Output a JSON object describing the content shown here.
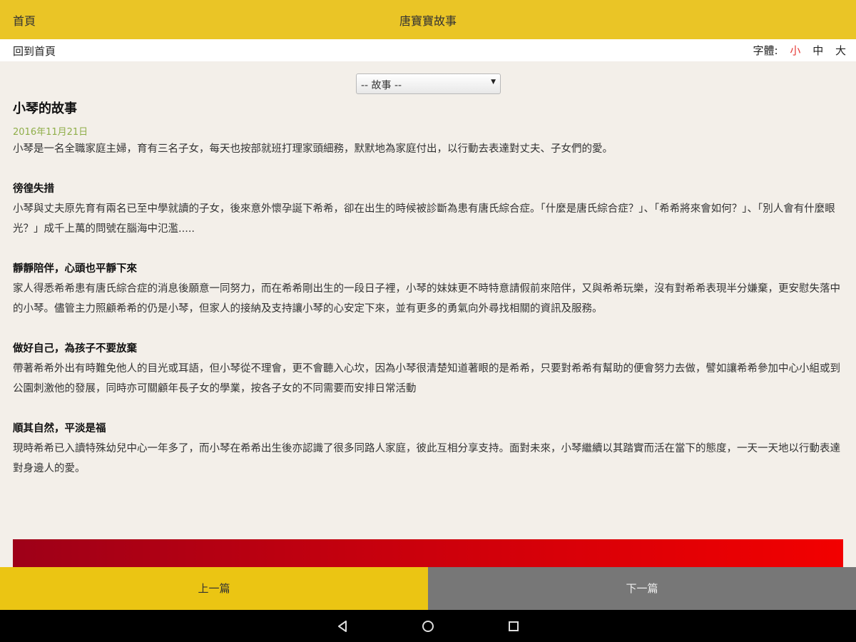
{
  "header": {
    "home_label": "首頁",
    "title": "唐寶寶故事"
  },
  "subbar": {
    "back_label": "回到首頁",
    "font_label": "字體:",
    "font_sizes": [
      "小",
      "中",
      "大"
    ],
    "active_font_color": "#e53935"
  },
  "selector": {
    "value": "-- 故事 --",
    "caret": "▼"
  },
  "article": {
    "title": "小琴的故事",
    "date": "2016年11月21日",
    "intro": "小琴是一名全職家庭主婦，育有三名子女，每天也按部就班打理家頭細務，默默地為家庭付出，以行動去表達對丈夫、子女們的愛。",
    "sections": [
      {
        "heading": "徬徨失措",
        "body": "小琴與丈夫原先育有兩名已至中學就讀的子女，後來意外懷孕誕下希希，卻在出生的時候被診斷為患有唐氏綜合症。「什麼是唐氏綜合症？」、「希希將來會如何？」、「別人會有什麼眼光？」成千上萬的問號在腦海中氾濫....."
      },
      {
        "heading": "靜靜陪伴，心頭也平靜下來",
        "body": "家人得悉希希患有唐氏綜合症的消息後願意一同努力，而在希希剛出生的一段日子裡，小琴的妹妹更不時特意請假前來陪伴，又與希希玩樂，沒有對希希表現半分嫌棄，更安慰失落中的小琴。儘管主力照顧希希的仍是小琴，但家人的接納及支持讓小琴的心安定下來，並有更多的勇氣向外尋找相關的資訊及服務。"
      },
      {
        "heading": "做好自己，為孩子不要放棄",
        "body": "帶著希希外出有時難免他人的目光或耳語，但小琴從不理會，更不會聽入心坎，因為小琴很清楚知道著眼的是希希，只要對希希有幫助的便會努力去做，譬如讓希希參加中心小組或到公園刺激他的發展，同時亦可關顧年長子女的學業，按各子女的不同需要而安排日常活動"
      },
      {
        "heading": "順其自然，平淡是福",
        "body": "現時希希已入讀特殊幼兒中心一年多了，而小琴在希希出生後亦認識了很多同路人家庭，彼此互相分享支持。面對未來，小琴繼續以其踏實而活在當下的態度，一天一天地以行動表達對身邊人的愛。"
      }
    ]
  },
  "banner": {
    "color_start": "#9e0018",
    "color_end": "#f20000"
  },
  "footer": {
    "prev_label": "上一篇",
    "next_label": "下一篇",
    "prev_color": "#ebc513",
    "next_color": "#777777"
  },
  "system_nav": {
    "icons": [
      "back-icon",
      "home-icon",
      "recents-icon"
    ]
  }
}
